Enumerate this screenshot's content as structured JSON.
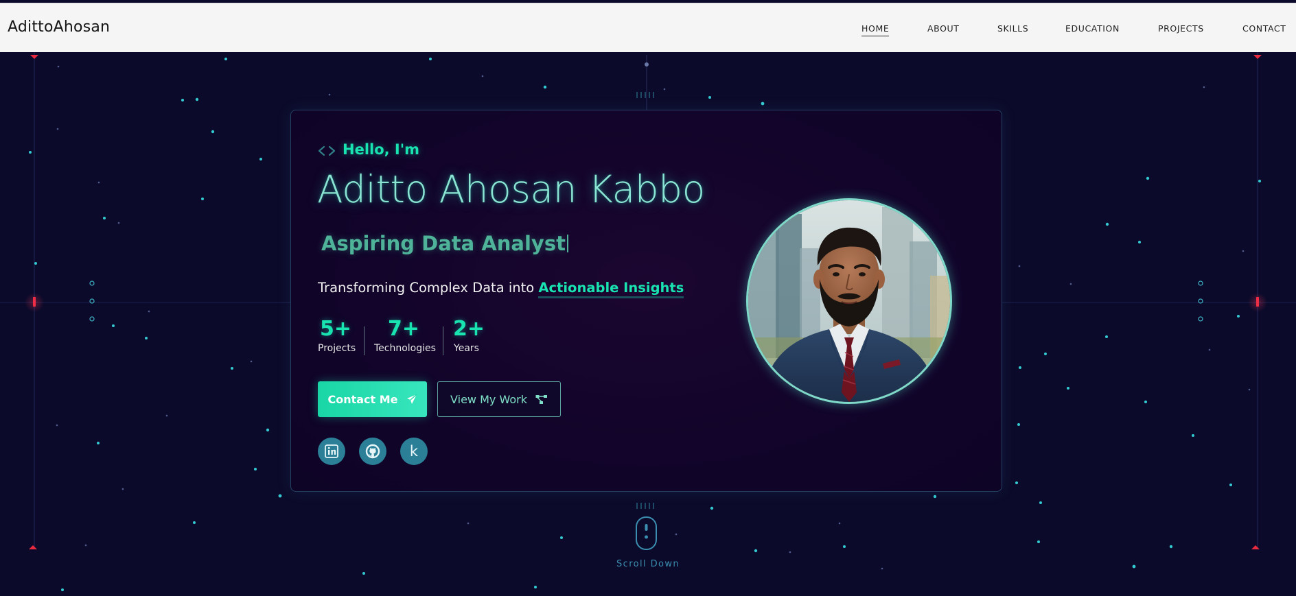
{
  "nav": {
    "brand": "AdittoAhosan",
    "items": [
      {
        "label": "HOME",
        "active": true
      },
      {
        "label": "ABOUT",
        "active": false
      },
      {
        "label": "SKILLS",
        "active": false
      },
      {
        "label": "EDUCATION",
        "active": false
      },
      {
        "label": "PROJECTS",
        "active": false
      },
      {
        "label": "CONTACT",
        "active": false
      }
    ]
  },
  "hero": {
    "greeting_icon": "code-brackets-icon",
    "greeting": "Hello, I'm",
    "name": "Aditto Ahosan Kabbo",
    "role": "Aspiring Data Analyst",
    "tagline_prefix": "Transforming Complex Data into ",
    "tagline_highlight": "Actionable Insights",
    "stats": [
      {
        "value": "5+",
        "label": "Projects"
      },
      {
        "value": "7+",
        "label": "Technologies"
      },
      {
        "value": "2+",
        "label": "Years"
      }
    ],
    "buttons": {
      "primary_label": "Contact Me",
      "primary_icon": "paper-plane-icon",
      "secondary_label": "View My Work",
      "secondary_icon": "project-diagram-icon"
    },
    "social": [
      {
        "name": "linkedin-icon"
      },
      {
        "name": "github-icon"
      },
      {
        "name": "kaggle-icon",
        "glyph": "k"
      }
    ],
    "profile_photo": "profile-photo"
  },
  "scroll_hint": "Scroll Down",
  "colors": {
    "background": "#0c0a2a",
    "card": "#12042a",
    "accent": "#19e3b1",
    "name_glow": "#8be5d3",
    "social_bg": "#2b7f97",
    "navbar_bg": "#f5f5f5",
    "marker_red": "#e8293f"
  }
}
